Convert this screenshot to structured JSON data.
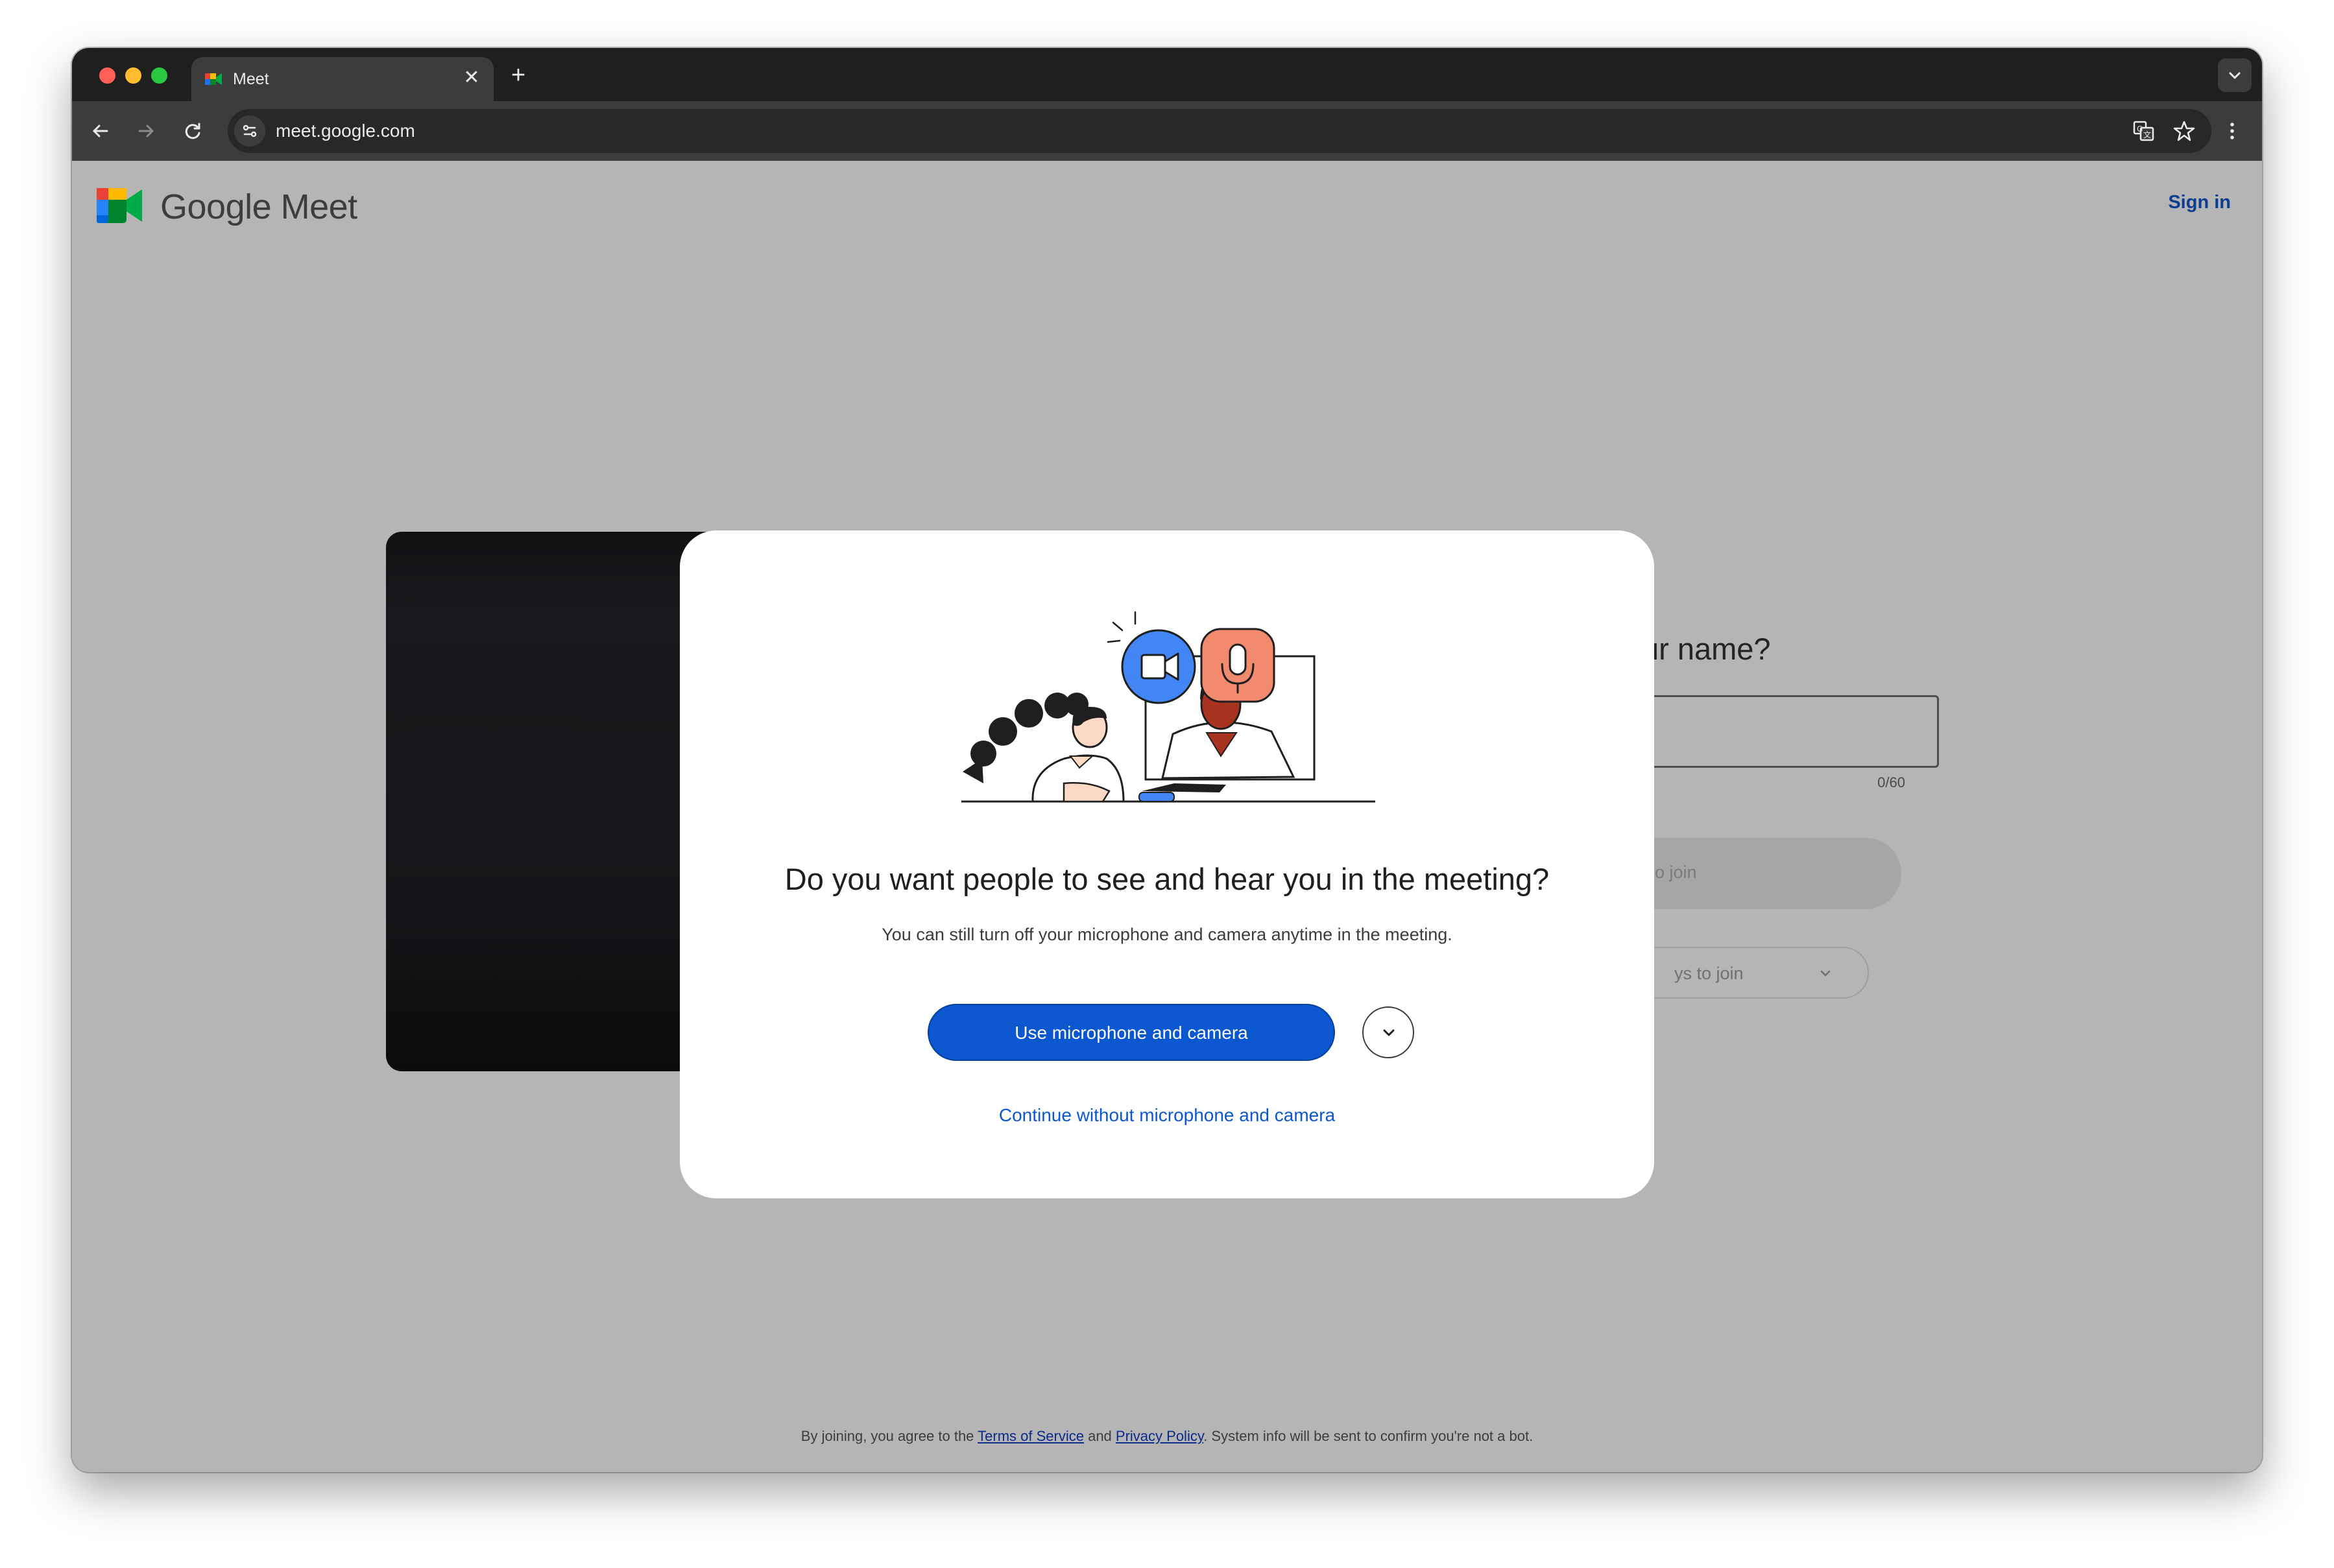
{
  "browser": {
    "tab_title": "Meet",
    "tab_close": "✕",
    "new_tab": "+",
    "url": "meet.google.com"
  },
  "header": {
    "brand": "Google Meet",
    "sign_in": "Sign in"
  },
  "join_panel": {
    "name_question": "ur name?",
    "name_counter": "0/60",
    "ask_to_join": "o join",
    "other_ways": "ys to join"
  },
  "dialog": {
    "title": "Do you want people to see and hear you in the meeting?",
    "subtitle": "You can still turn off your microphone and camera anytime in the meeting.",
    "primary_button": "Use microphone and camera",
    "secondary_link": "Continue without microphone and camera"
  },
  "footer": {
    "prefix": "By joining, you agree to the ",
    "terms": "Terms of Service",
    "and": " and ",
    "privacy": "Privacy Policy",
    "suffix": ". System info will be sent to confirm you're not a bot."
  },
  "colors": {
    "accent": "#0b57d0",
    "camera_badge": "#4285f4",
    "mic_badge": "#f28b6e",
    "overlay": "#b5b5b5"
  },
  "icons": [
    "meet-favicon-icon",
    "close-icon",
    "plus-icon",
    "chevron-down-icon",
    "back-arrow-icon",
    "forward-arrow-icon",
    "reload-icon",
    "site-info-icon",
    "translate-icon",
    "star-icon",
    "more-vert-icon",
    "meet-logo-icon",
    "camera-icon",
    "microphone-icon"
  ]
}
